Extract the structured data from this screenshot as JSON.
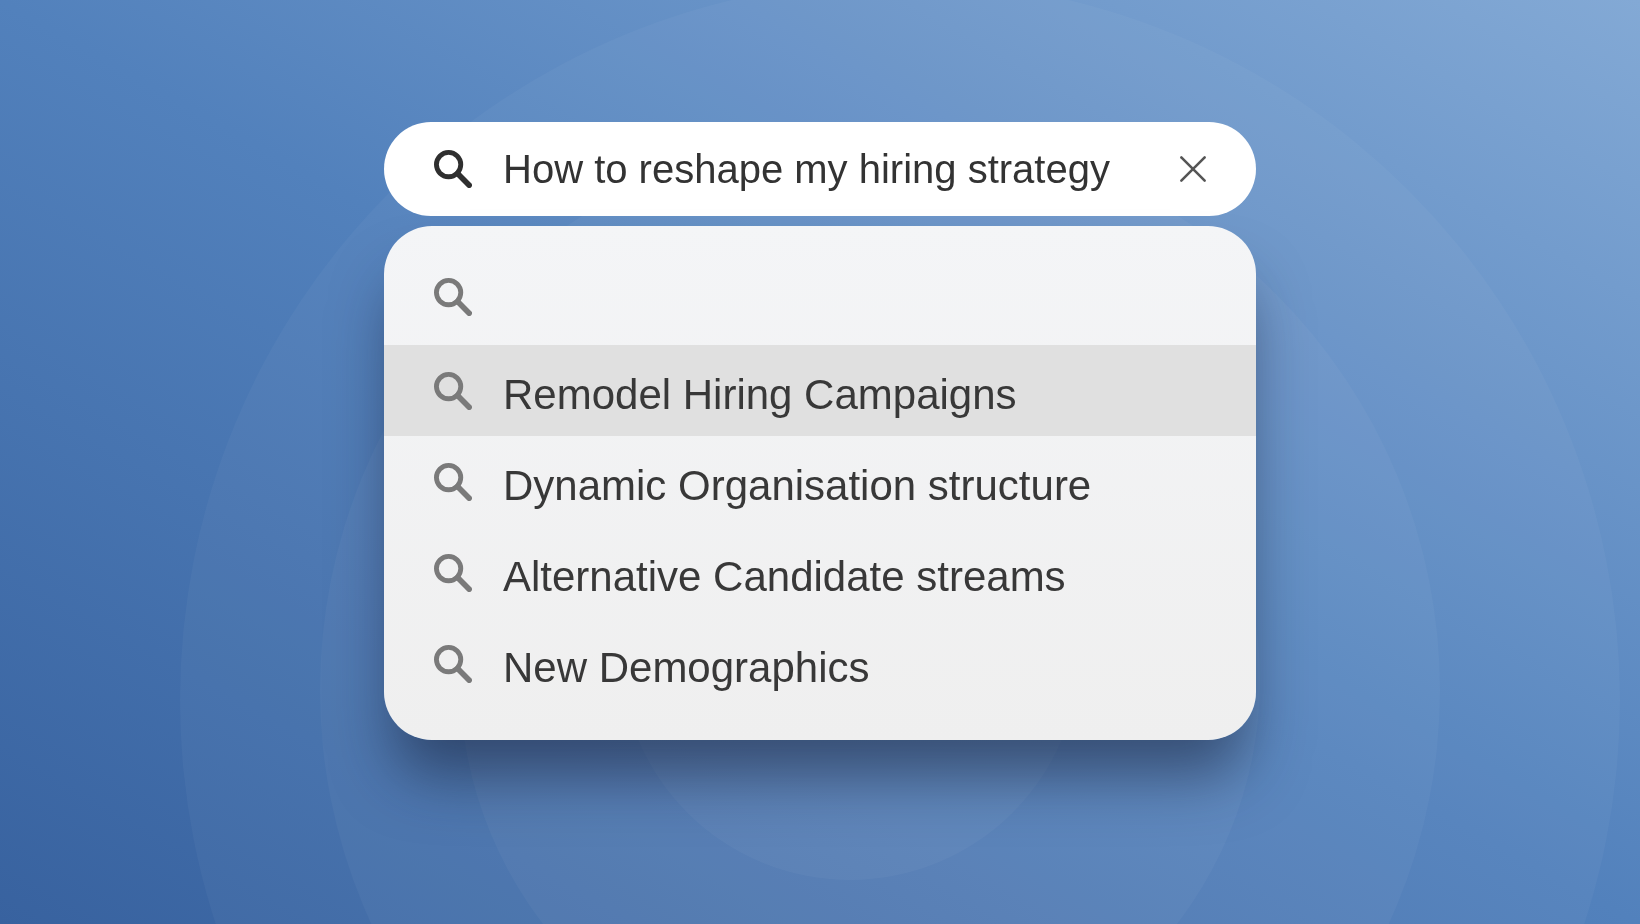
{
  "search": {
    "value": "How to reshape my hiring strategy"
  },
  "suggestions": [
    {
      "selected": false
    },
    {
      "text": "Remodel Hiring Campaigns",
      "selected": true
    },
    {
      "text": "Dynamic Organisation structure",
      "selected": false
    },
    {
      "text": "Alternative Candidate streams",
      "selected": false
    },
    {
      "text": "New Demographics",
      "selected": false
    }
  ]
}
